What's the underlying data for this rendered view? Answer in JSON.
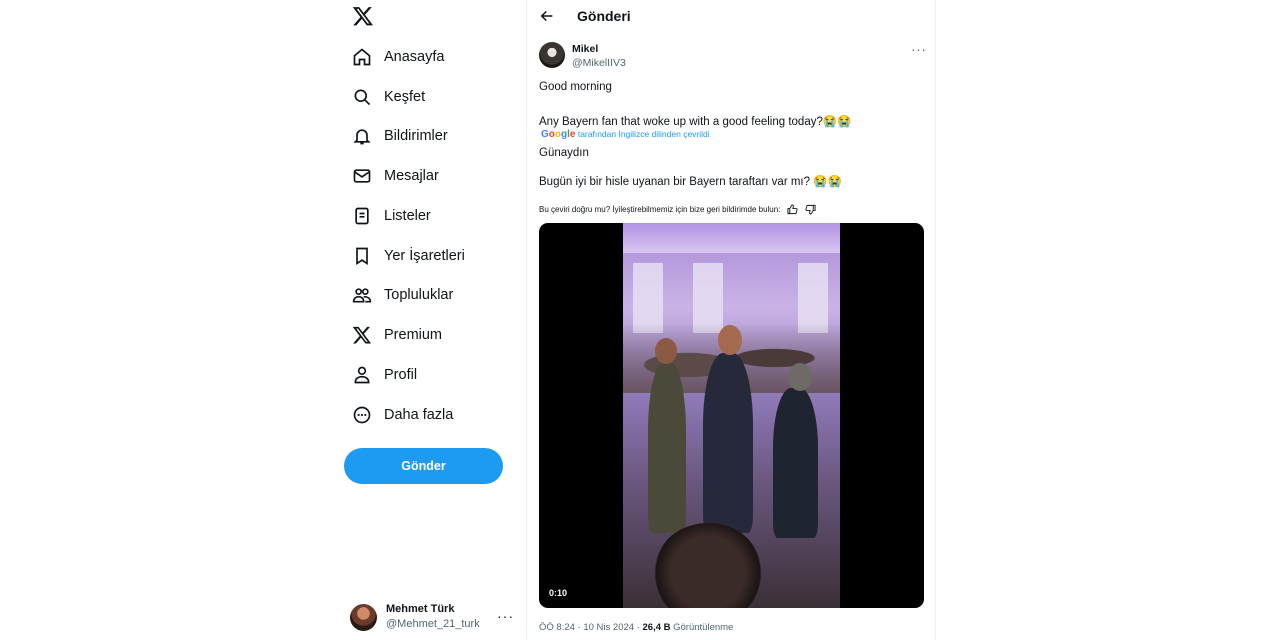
{
  "sidebar": {
    "logo": "x-logo-icon",
    "items": [
      {
        "label": "Anasayfa",
        "icon": "home-icon"
      },
      {
        "label": "Keşfet",
        "icon": "search-icon"
      },
      {
        "label": "Bildirimler",
        "icon": "bell-icon"
      },
      {
        "label": "Mesajlar",
        "icon": "mail-icon"
      },
      {
        "label": "Listeler",
        "icon": "list-icon"
      },
      {
        "label": "Yer İşaretleri",
        "icon": "bookmark-icon"
      },
      {
        "label": "Topluluklar",
        "icon": "communities-icon"
      },
      {
        "label": "Premium",
        "icon": "x-logo-icon"
      },
      {
        "label": "Profil",
        "icon": "person-icon"
      },
      {
        "label": "Daha fazla",
        "icon": "more-circle-icon"
      }
    ],
    "post_button": "Gönder",
    "account": {
      "name": "Mehmet Türk",
      "handle": "@Mehmet_21_turk",
      "more": "···"
    }
  },
  "header": {
    "title": "Gönderi"
  },
  "tweet": {
    "author_name": "Mikel",
    "author_handle": "@MikelIIV3",
    "more": "···",
    "line1": "Good morning",
    "line2": "Any Bayern fan that woke up with a good feeling today?😭😭",
    "translated_by": "tarafından İngilizce dilinden çevrildi",
    "translation_provider": "Google",
    "translation_line1": "Günaydın",
    "translation_line2": "Bugün iyi bir hisle uyanan bir Bayern taraftarı var mı? 😭😭",
    "feedback_text": "Bu çeviri doğru mu? İyileştirebilmemiz için bize geri bildirimde bulun:",
    "video_time": "0:10",
    "meta_time": "ÖÖ 8:24 · 10 Nis 2024 · ",
    "views_count": "26,4 B",
    "views_label": " Görüntülenme"
  }
}
